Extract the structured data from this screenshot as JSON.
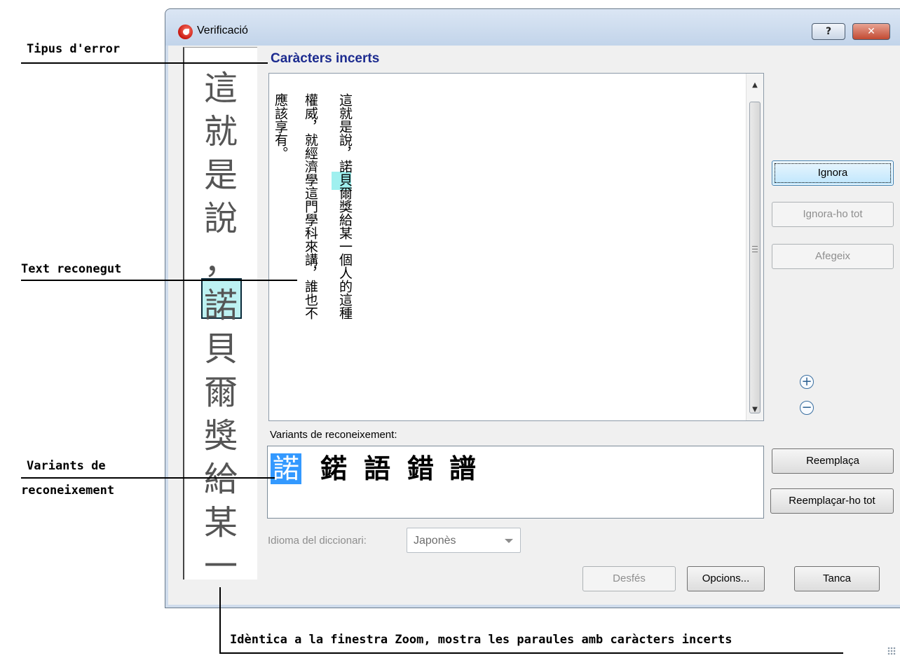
{
  "window": {
    "title": "Verificació"
  },
  "titlebar": {
    "help_glyph": "?",
    "close_glyph": "✕"
  },
  "error_type": {
    "title": "Caràcters incerts"
  },
  "zoom_strip": {
    "characters": [
      "這",
      "就",
      "是",
      "說",
      "，",
      "諾",
      "貝",
      "爾",
      "獎",
      "給",
      "某",
      "一"
    ]
  },
  "recognized_text": {
    "columns": [
      "這就是說，諾貝爾獎給某一個人的這種",
      "權威，就經濟學這門學科來講，誰也不",
      "應該享有。"
    ]
  },
  "scrollbar": {
    "up": "▲",
    "down": "▼"
  },
  "buttons": {
    "ignore": "Ignora",
    "ignore_all": "Ignora-ho tot",
    "add": "Afegeix",
    "replace": "Reemplaça",
    "replace_all": "Reemplaçar-ho tot",
    "undo": "Desfés",
    "options": "Opcions...",
    "close": "Tanca"
  },
  "zoom_controls": {
    "zoom_in": "+",
    "zoom_out": "−"
  },
  "variants": {
    "label": "Variants de reconeixement:",
    "items": [
      "諾",
      "鍩",
      "語",
      "錯",
      "譜"
    ],
    "selected_index": 0
  },
  "dictionary": {
    "label": "Idioma del diccionari:",
    "value": "Japonès"
  },
  "annotations": {
    "error_type": "Tipus d'error",
    "recognized_text": "Text reconegut",
    "variants_line1": "Variants de",
    "variants_line2": "reconeixement",
    "zoom_note": "Idèntica a la finestra Zoom, mostra les paraules amb caràcters incerts"
  },
  "colors": {
    "title_blue": "#1c2b8f",
    "uncertain_highlight": "#9ff0ef",
    "variant_selected": "#3399ff"
  }
}
